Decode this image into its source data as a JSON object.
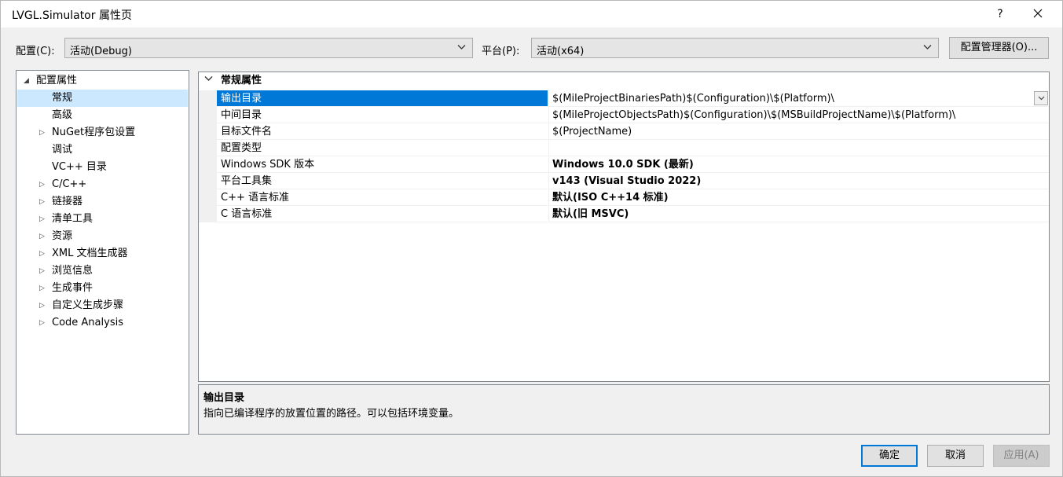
{
  "window": {
    "title": "LVGL.Simulator 属性页",
    "help": "?"
  },
  "toolbar": {
    "config_label": "配置(C):",
    "config_value": "活动(Debug)",
    "platform_label": "平台(P):",
    "platform_value": "活动(x64)",
    "config_manager": "配置管理器(O)..."
  },
  "tree": [
    {
      "label": "配置属性",
      "level": 0,
      "expander": "expanded"
    },
    {
      "label": "常规",
      "level": 1,
      "expander": "none",
      "selected": true
    },
    {
      "label": "高级",
      "level": 1,
      "expander": "none"
    },
    {
      "label": "NuGet程序包设置",
      "level": 1,
      "expander": "collapsed"
    },
    {
      "label": "调试",
      "level": 1,
      "expander": "none"
    },
    {
      "label": "VC++ 目录",
      "level": 1,
      "expander": "none"
    },
    {
      "label": "C/C++",
      "level": 1,
      "expander": "collapsed"
    },
    {
      "label": "链接器",
      "level": 1,
      "expander": "collapsed"
    },
    {
      "label": "清单工具",
      "level": 1,
      "expander": "collapsed"
    },
    {
      "label": "资源",
      "level": 1,
      "expander": "collapsed"
    },
    {
      "label": "XML 文档生成器",
      "level": 1,
      "expander": "collapsed"
    },
    {
      "label": "浏览信息",
      "level": 1,
      "expander": "collapsed"
    },
    {
      "label": "生成事件",
      "level": 1,
      "expander": "collapsed"
    },
    {
      "label": "自定义生成步骤",
      "level": 1,
      "expander": "collapsed"
    },
    {
      "label": "Code Analysis",
      "level": 1,
      "expander": "collapsed"
    }
  ],
  "grid": {
    "category": "常规属性",
    "rows": [
      {
        "name": "输出目录",
        "value": "$(MileProjectBinariesPath)$(Configuration)\\$(Platform)\\",
        "bold": false,
        "selected": true
      },
      {
        "name": "中间目录",
        "value": "$(MileProjectObjectsPath)$(Configuration)\\$(MSBuildProjectName)\\$(Platform)\\",
        "bold": false
      },
      {
        "name": "目标文件名",
        "value": "$(ProjectName)",
        "bold": false
      },
      {
        "name": "配置类型",
        "value": "",
        "bold": false
      },
      {
        "name": "Windows SDK 版本",
        "value": "Windows 10.0 SDK (最新)",
        "bold": true
      },
      {
        "name": "平台工具集",
        "value": "v143 (Visual Studio 2022)",
        "bold": true
      },
      {
        "name": "C++ 语言标准",
        "value": "默认(ISO C++14 标准)",
        "bold": true
      },
      {
        "name": "C 语言标准",
        "value": "默认(旧 MSVC)",
        "bold": true
      }
    ]
  },
  "description": {
    "title": "输出目录",
    "text": "指向已编译程序的放置位置的路径。可以包括环境变量。"
  },
  "buttons": {
    "ok": "确定",
    "cancel": "取消",
    "apply": "应用(A)"
  },
  "colors": {
    "selection": "#0078d7",
    "tree_selection": "#cce8ff"
  }
}
